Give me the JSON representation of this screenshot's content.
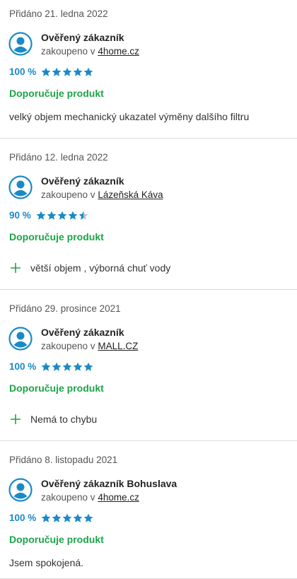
{
  "colors": {
    "accent_blue": "#1a8ac6",
    "recommend_green": "#1ba548",
    "divider": "#d9d9d9",
    "star_empty": "#b8c4cc"
  },
  "icons": {
    "avatar": "user-avatar-icon",
    "star": "star-icon",
    "pro": "plus-icon"
  },
  "reviews": [
    {
      "date": "Přidáno 21. ledna 2022",
      "name": "Ověřený zákazník",
      "bought_prefix": "zakoupeno v",
      "shop": "4home.cz",
      "rating_text": "100 %",
      "rating_fraction": 1.0,
      "recommend": "Doporučuje produkt",
      "text": "velký objem mechanický ukazatel výměny dalšího filtru"
    },
    {
      "date": "Přidáno 12. ledna 2022",
      "name": "Ověřený zákazník",
      "bought_prefix": "zakoupeno v",
      "shop": "Lázeňská Káva",
      "rating_text": "90 %",
      "rating_fraction": 0.9,
      "recommend": "Doporučuje produkt",
      "pro": "větší objem , výborná chuť vody"
    },
    {
      "date": "Přidáno 29. prosince 2021",
      "name": "Ověřený zákazník",
      "bought_prefix": "zakoupeno v",
      "shop": "MALL.CZ",
      "rating_text": "100 %",
      "rating_fraction": 1.0,
      "recommend": "Doporučuje produkt",
      "pro": "Nemá to chybu"
    },
    {
      "date": "Přidáno 8. listopadu 2021",
      "name": "Ověřený zákazník Bohuslava",
      "bought_prefix": "zakoupeno v",
      "shop": "4home.cz",
      "rating_text": "100 %",
      "rating_fraction": 1.0,
      "recommend": "Doporučuje produkt",
      "text": "Jsem spokojená."
    }
  ]
}
